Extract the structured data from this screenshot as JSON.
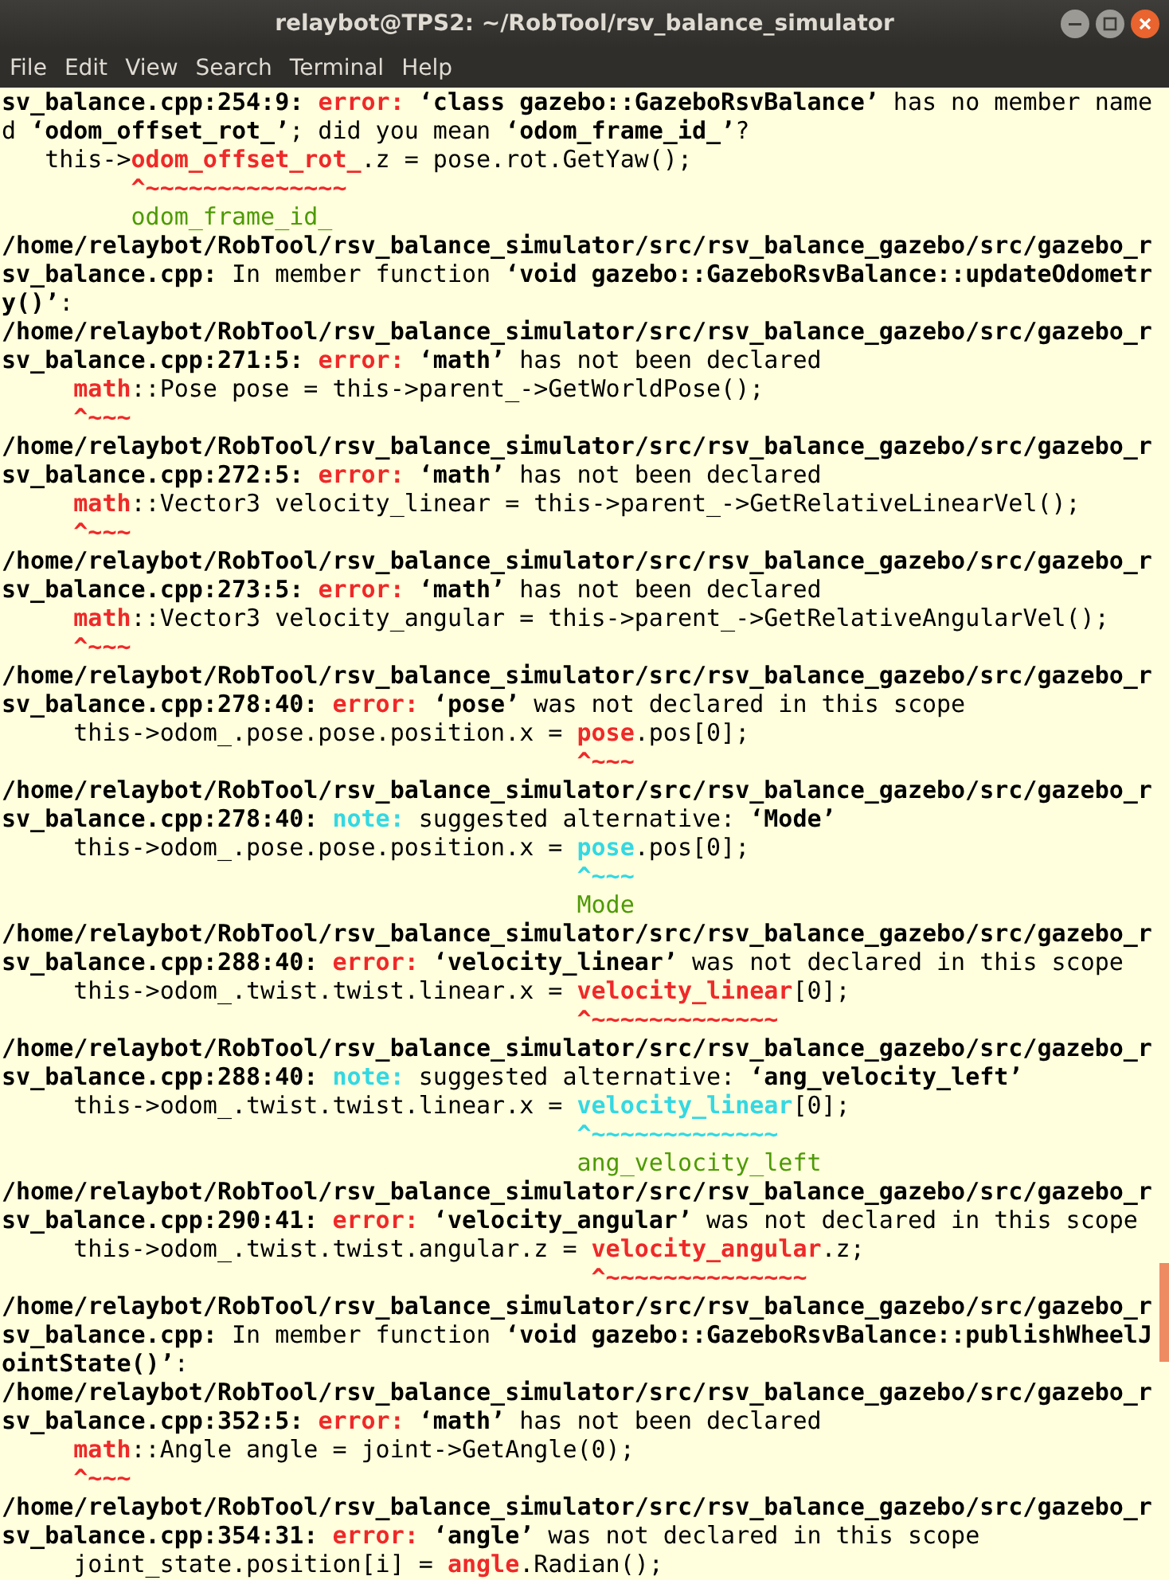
{
  "window": {
    "title": "relaybot@TPS2: ~/RobTool/rsv_balance_simulator"
  },
  "menu": [
    "File",
    "Edit",
    "View",
    "Search",
    "Terminal",
    "Help"
  ],
  "lines": [
    {
      "segments": [
        {
          "kind": "bold",
          "text": "sv_balance.cpp:254:9: "
        },
        {
          "kind": "error",
          "text": "error: "
        },
        {
          "kind": "bold",
          "text": "‘class gazebo::GazeboRsvBalance’"
        },
        {
          "kind": "plain",
          "text": " has no member name"
        }
      ]
    },
    {
      "segments": [
        {
          "kind": "plain",
          "text": "d "
        },
        {
          "kind": "bold",
          "text": "‘odom_offset_rot_’"
        },
        {
          "kind": "plain",
          "text": "; did you mean "
        },
        {
          "kind": "bold",
          "text": "‘odom_frame_id_’"
        },
        {
          "kind": "plain",
          "text": "?"
        }
      ]
    },
    {
      "segments": [
        {
          "kind": "plain",
          "text": "   this->"
        },
        {
          "kind": "red",
          "text": "odom_offset_rot_"
        },
        {
          "kind": "plain",
          "text": ".z = pose.rot.GetYaw();"
        }
      ]
    },
    {
      "segments": [
        {
          "kind": "red",
          "text": "         ^~~~~~~~~~~~~~~"
        }
      ]
    },
    {
      "segments": [
        {
          "kind": "green",
          "text": "         odom_frame_id_"
        }
      ]
    },
    {
      "segments": [
        {
          "kind": "bold",
          "text": "/home/relaybot/RobTool/rsv_balance_simulator/src/rsv_balance_gazebo/src/gazebo_r"
        }
      ]
    },
    {
      "segments": [
        {
          "kind": "bold",
          "text": "sv_balance.cpp:"
        },
        {
          "kind": "plain",
          "text": " In member function "
        },
        {
          "kind": "bold",
          "text": "‘void gazebo::GazeboRsvBalance::updateOdometr"
        }
      ]
    },
    {
      "segments": [
        {
          "kind": "bold",
          "text": "y()’"
        },
        {
          "kind": "plain",
          "text": ":"
        }
      ]
    },
    {
      "segments": [
        {
          "kind": "bold",
          "text": "/home/relaybot/RobTool/rsv_balance_simulator/src/rsv_balance_gazebo/src/gazebo_r"
        }
      ]
    },
    {
      "segments": [
        {
          "kind": "bold",
          "text": "sv_balance.cpp:271:5: "
        },
        {
          "kind": "error",
          "text": "error: "
        },
        {
          "kind": "bold",
          "text": "‘math’"
        },
        {
          "kind": "plain",
          "text": " has not been declared"
        }
      ]
    },
    {
      "segments": [
        {
          "kind": "red",
          "text": "     math"
        },
        {
          "kind": "plain",
          "text": "::Pose pose = this->parent_->GetWorldPose();"
        }
      ]
    },
    {
      "segments": [
        {
          "kind": "red",
          "text": "     ^~~~"
        }
      ]
    },
    {
      "segments": [
        {
          "kind": "bold",
          "text": "/home/relaybot/RobTool/rsv_balance_simulator/src/rsv_balance_gazebo/src/gazebo_r"
        }
      ]
    },
    {
      "segments": [
        {
          "kind": "bold",
          "text": "sv_balance.cpp:272:5: "
        },
        {
          "kind": "error",
          "text": "error: "
        },
        {
          "kind": "bold",
          "text": "‘math’"
        },
        {
          "kind": "plain",
          "text": " has not been declared"
        }
      ]
    },
    {
      "segments": [
        {
          "kind": "red",
          "text": "     math"
        },
        {
          "kind": "plain",
          "text": "::Vector3 velocity_linear = this->parent_->GetRelativeLinearVel();"
        }
      ]
    },
    {
      "segments": [
        {
          "kind": "red",
          "text": "     ^~~~"
        }
      ]
    },
    {
      "segments": [
        {
          "kind": "bold",
          "text": "/home/relaybot/RobTool/rsv_balance_simulator/src/rsv_balance_gazebo/src/gazebo_r"
        }
      ]
    },
    {
      "segments": [
        {
          "kind": "bold",
          "text": "sv_balance.cpp:273:5: "
        },
        {
          "kind": "error",
          "text": "error: "
        },
        {
          "kind": "bold",
          "text": "‘math’"
        },
        {
          "kind": "plain",
          "text": " has not been declared"
        }
      ]
    },
    {
      "segments": [
        {
          "kind": "red",
          "text": "     math"
        },
        {
          "kind": "plain",
          "text": "::Vector3 velocity_angular = this->parent_->GetRelativeAngularVel();"
        }
      ]
    },
    {
      "segments": [
        {
          "kind": "red",
          "text": "     ^~~~"
        }
      ]
    },
    {
      "segments": [
        {
          "kind": "bold",
          "text": "/home/relaybot/RobTool/rsv_balance_simulator/src/rsv_balance_gazebo/src/gazebo_r"
        }
      ]
    },
    {
      "segments": [
        {
          "kind": "bold",
          "text": "sv_balance.cpp:278:40: "
        },
        {
          "kind": "error",
          "text": "error: "
        },
        {
          "kind": "bold",
          "text": "‘pose’"
        },
        {
          "kind": "plain",
          "text": " was not declared in this scope"
        }
      ]
    },
    {
      "segments": [
        {
          "kind": "plain",
          "text": "     this->odom_.pose.pose.position.x = "
        },
        {
          "kind": "red",
          "text": "pose"
        },
        {
          "kind": "plain",
          "text": ".pos[0];"
        }
      ]
    },
    {
      "segments": [
        {
          "kind": "red",
          "text": "                                        ^~~~"
        }
      ]
    },
    {
      "segments": [
        {
          "kind": "bold",
          "text": "/home/relaybot/RobTool/rsv_balance_simulator/src/rsv_balance_gazebo/src/gazebo_r"
        }
      ]
    },
    {
      "segments": [
        {
          "kind": "bold",
          "text": "sv_balance.cpp:278:40: "
        },
        {
          "kind": "note",
          "text": "note: "
        },
        {
          "kind": "plain",
          "text": "suggested alternative: "
        },
        {
          "kind": "bold",
          "text": "‘Mode’"
        }
      ]
    },
    {
      "segments": [
        {
          "kind": "plain",
          "text": "     this->odom_.pose.pose.position.x = "
        },
        {
          "kind": "cyan",
          "text": "pose"
        },
        {
          "kind": "plain",
          "text": ".pos[0];"
        }
      ]
    },
    {
      "segments": [
        {
          "kind": "cyan",
          "text": "                                        ^~~~"
        }
      ]
    },
    {
      "segments": [
        {
          "kind": "green",
          "text": "                                        Mode"
        }
      ]
    },
    {
      "segments": [
        {
          "kind": "bold",
          "text": "/home/relaybot/RobTool/rsv_balance_simulator/src/rsv_balance_gazebo/src/gazebo_r"
        }
      ]
    },
    {
      "segments": [
        {
          "kind": "bold",
          "text": "sv_balance.cpp:288:40: "
        },
        {
          "kind": "error",
          "text": "error: "
        },
        {
          "kind": "bold",
          "text": "‘velocity_linear’"
        },
        {
          "kind": "plain",
          "text": " was not declared in this scope"
        }
      ]
    },
    {
      "segments": [
        {
          "kind": "plain",
          "text": "     this->odom_.twist.twist.linear.x = "
        },
        {
          "kind": "red",
          "text": "velocity_linear"
        },
        {
          "kind": "plain",
          "text": "[0];"
        }
      ]
    },
    {
      "segments": [
        {
          "kind": "red",
          "text": "                                        ^~~~~~~~~~~~~~"
        }
      ]
    },
    {
      "segments": [
        {
          "kind": "bold",
          "text": "/home/relaybot/RobTool/rsv_balance_simulator/src/rsv_balance_gazebo/src/gazebo_r"
        }
      ]
    },
    {
      "segments": [
        {
          "kind": "bold",
          "text": "sv_balance.cpp:288:40: "
        },
        {
          "kind": "note",
          "text": "note: "
        },
        {
          "kind": "plain",
          "text": "suggested alternative: "
        },
        {
          "kind": "bold",
          "text": "‘ang_velocity_left’"
        }
      ]
    },
    {
      "segments": [
        {
          "kind": "plain",
          "text": "     this->odom_.twist.twist.linear.x = "
        },
        {
          "kind": "cyan",
          "text": "velocity_linear"
        },
        {
          "kind": "plain",
          "text": "[0];"
        }
      ]
    },
    {
      "segments": [
        {
          "kind": "cyan",
          "text": "                                        ^~~~~~~~~~~~~~"
        }
      ]
    },
    {
      "segments": [
        {
          "kind": "green",
          "text": "                                        ang_velocity_left"
        }
      ]
    },
    {
      "segments": [
        {
          "kind": "bold",
          "text": "/home/relaybot/RobTool/rsv_balance_simulator/src/rsv_balance_gazebo/src/gazebo_r"
        }
      ]
    },
    {
      "segments": [
        {
          "kind": "bold",
          "text": "sv_balance.cpp:290:41: "
        },
        {
          "kind": "error",
          "text": "error: "
        },
        {
          "kind": "bold",
          "text": "‘velocity_angular’"
        },
        {
          "kind": "plain",
          "text": " was not declared in this scope"
        }
      ]
    },
    {
      "segments": [
        {
          "kind": "plain",
          "text": "     this->odom_.twist.twist.angular.z = "
        },
        {
          "kind": "red",
          "text": "velocity_angular"
        },
        {
          "kind": "plain",
          "text": ".z;"
        }
      ]
    },
    {
      "segments": [
        {
          "kind": "red",
          "text": "                                         ^~~~~~~~~~~~~~~"
        }
      ]
    },
    {
      "segments": [
        {
          "kind": "bold",
          "text": "/home/relaybot/RobTool/rsv_balance_simulator/src/rsv_balance_gazebo/src/gazebo_r"
        }
      ]
    },
    {
      "segments": [
        {
          "kind": "bold",
          "text": "sv_balance.cpp:"
        },
        {
          "kind": "plain",
          "text": " In member function "
        },
        {
          "kind": "bold",
          "text": "‘void gazebo::GazeboRsvBalance::publishWheelJ"
        }
      ]
    },
    {
      "segments": [
        {
          "kind": "bold",
          "text": "ointState()’"
        },
        {
          "kind": "plain",
          "text": ":"
        }
      ]
    },
    {
      "segments": [
        {
          "kind": "bold",
          "text": "/home/relaybot/RobTool/rsv_balance_simulator/src/rsv_balance_gazebo/src/gazebo_r"
        }
      ]
    },
    {
      "segments": [
        {
          "kind": "bold",
          "text": "sv_balance.cpp:352:5: "
        },
        {
          "kind": "error",
          "text": "error: "
        },
        {
          "kind": "bold",
          "text": "‘math’"
        },
        {
          "kind": "plain",
          "text": " has not been declared"
        }
      ]
    },
    {
      "segments": [
        {
          "kind": "red",
          "text": "     math"
        },
        {
          "kind": "plain",
          "text": "::Angle angle = joint->GetAngle(0);"
        }
      ]
    },
    {
      "segments": [
        {
          "kind": "red",
          "text": "     ^~~~"
        }
      ]
    },
    {
      "segments": [
        {
          "kind": "bold",
          "text": "/home/relaybot/RobTool/rsv_balance_simulator/src/rsv_balance_gazebo/src/gazebo_r"
        }
      ]
    },
    {
      "segments": [
        {
          "kind": "bold",
          "text": "sv_balance.cpp:354:31: "
        },
        {
          "kind": "error",
          "text": "error: "
        },
        {
          "kind": "bold",
          "text": "‘angle’"
        },
        {
          "kind": "plain",
          "text": " was not declared in this scope"
        }
      ]
    },
    {
      "segments": [
        {
          "kind": "plain",
          "text": "     joint_state.position[i] = "
        },
        {
          "kind": "red",
          "text": "angle"
        },
        {
          "kind": "plain",
          "text": ".Radian();"
        }
      ]
    }
  ]
}
